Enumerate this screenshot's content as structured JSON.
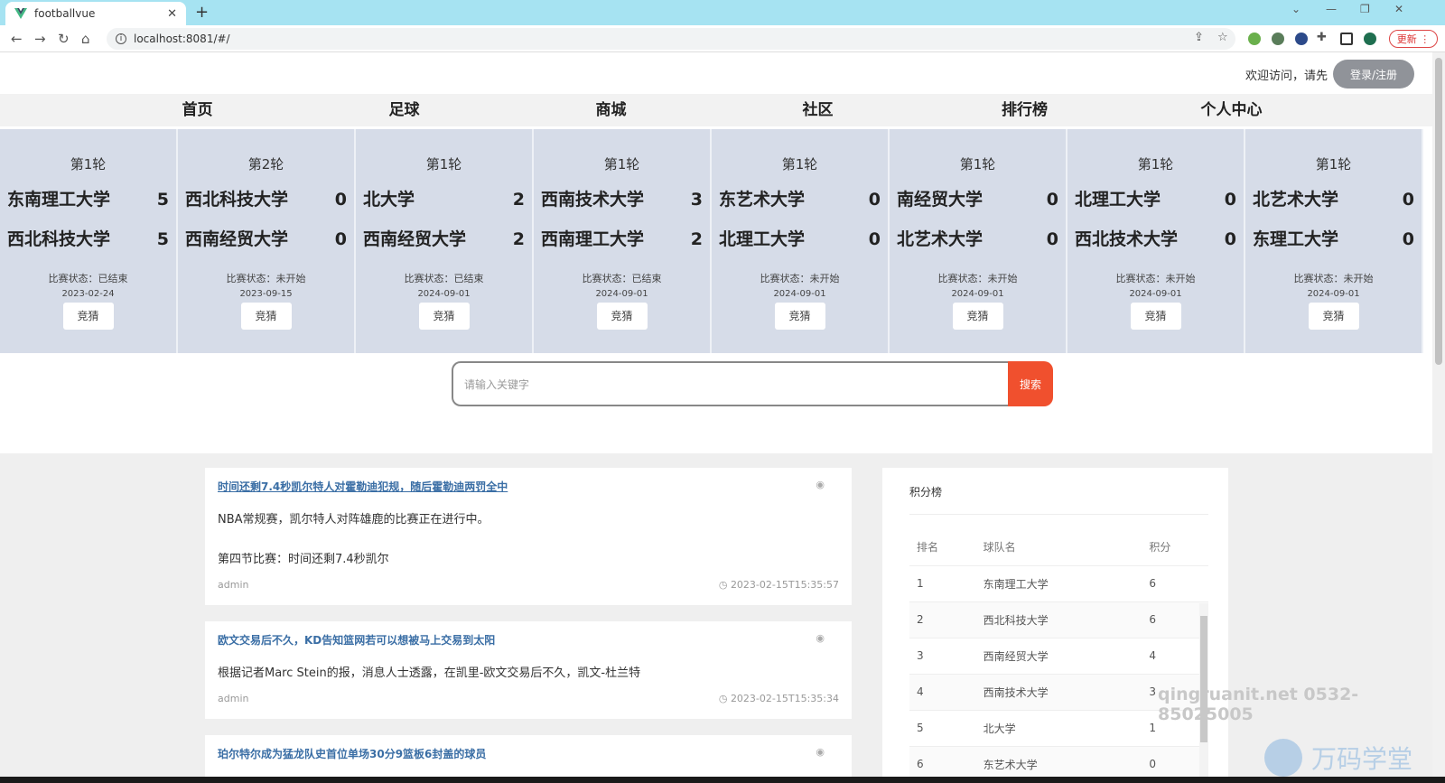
{
  "browser": {
    "tab_title": "footballvue",
    "url": "localhost:8081/#/",
    "update_label": "更新"
  },
  "header": {
    "welcome_text": "欢迎访问，请先",
    "login_label": "登录/注册"
  },
  "nav": [
    "首页",
    "足球",
    "商城",
    "社区",
    "排行榜",
    "个人中心"
  ],
  "matches": [
    {
      "round": "第1轮",
      "home": "东南理工大学",
      "home_score": "5",
      "away": "西北科技大学",
      "away_score": "5",
      "status": "比赛状态：已结束",
      "date": "2023-02-24",
      "guess": "竞猜"
    },
    {
      "round": "第2轮",
      "home": "西北科技大学",
      "home_score": "0",
      "away": "西南经贸大学",
      "away_score": "0",
      "status": "比赛状态：未开始",
      "date": "2023-09-15",
      "guess": "竞猜"
    },
    {
      "round": "第1轮",
      "home": "北大学",
      "home_score": "2",
      "away": "西南经贸大学",
      "away_score": "2",
      "status": "比赛状态：已结束",
      "date": "2024-09-01",
      "guess": "竞猜"
    },
    {
      "round": "第1轮",
      "home": "西南技术大学",
      "home_score": "3",
      "away": "西南理工大学",
      "away_score": "2",
      "status": "比赛状态：已结束",
      "date": "2024-09-01",
      "guess": "竞猜"
    },
    {
      "round": "第1轮",
      "home": "东艺术大学",
      "home_score": "0",
      "away": "北理工大学",
      "away_score": "0",
      "status": "比赛状态：未开始",
      "date": "2024-09-01",
      "guess": "竞猜"
    },
    {
      "round": "第1轮",
      "home": "南经贸大学",
      "home_score": "0",
      "away": "北艺术大学",
      "away_score": "0",
      "status": "比赛状态：未开始",
      "date": "2024-09-01",
      "guess": "竞猜"
    },
    {
      "round": "第1轮",
      "home": "北理工大学",
      "home_score": "0",
      "away": "西北技术大学",
      "away_score": "0",
      "status": "比赛状态：未开始",
      "date": "2024-09-01",
      "guess": "竞猜"
    },
    {
      "round": "第1轮",
      "home": "北艺术大学",
      "home_score": "0",
      "away": "东理工大学",
      "away_score": "0",
      "status": "比赛状态：未开始",
      "date": "2024-09-01",
      "guess": "竞猜"
    }
  ],
  "search": {
    "placeholder": "请输入关键字",
    "button_label": "搜索"
  },
  "posts": [
    {
      "title": "时间还剩7.4秒凯尔特人对霍勒迪犯规，随后霍勒迪两罚全中",
      "body": [
        "NBA常规赛，凯尔特人对阵雄鹿的比赛正在进行中。",
        "第四节比赛：时间还剩7.4秒凯尔"
      ],
      "author": "admin",
      "time": "2023-02-15T15:35:57"
    },
    {
      "title": "欧文交易后不久，KD告知篮网若可以想被马上交易到太阳",
      "body": [
        "根据记者Marc Stein的报，消息人士透露，在凯里-欧文交易后不久，凯文-杜兰特"
      ],
      "author": "admin",
      "time": "2023-02-15T15:35:34"
    },
    {
      "title": "珀尔特尔成为猛龙队史首位单场30分9篮板6封盖的球员",
      "body": [],
      "author": "",
      "time": ""
    }
  ],
  "ranking": {
    "title": "积分榜",
    "headers": [
      "排名",
      "球队名",
      "积分"
    ],
    "rows": [
      [
        "1",
        "东南理工大学",
        "6"
      ],
      [
        "2",
        "西北科技大学",
        "6"
      ],
      [
        "3",
        "西南经贸大学",
        "4"
      ],
      [
        "4",
        "西南技术大学",
        "3"
      ],
      [
        "5",
        "北大学",
        "1"
      ],
      [
        "6",
        "东艺术大学",
        "0"
      ]
    ]
  },
  "watermark": {
    "text": "qingruanit.net 0532-85025005",
    "brand": "万码学堂"
  }
}
